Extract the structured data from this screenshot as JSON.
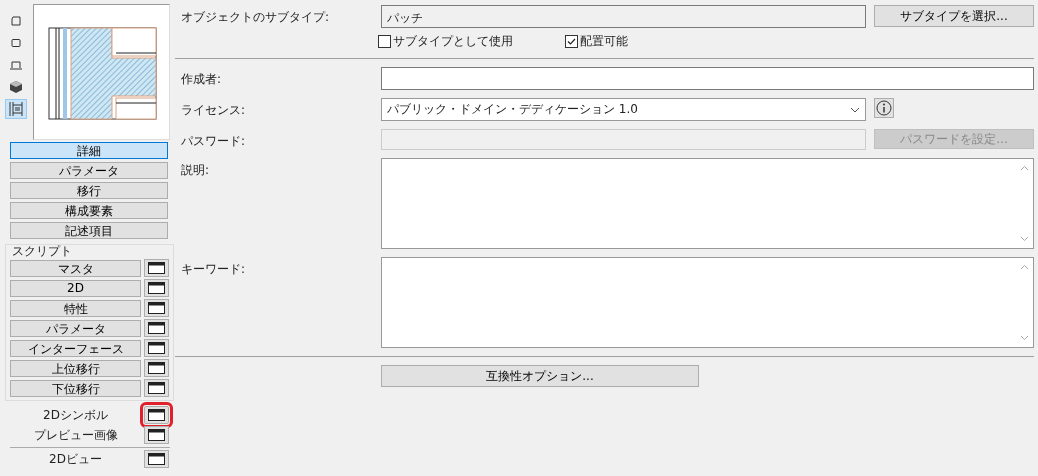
{
  "view_icons": [
    {
      "kind": "outline",
      "selected": false
    },
    {
      "kind": "square",
      "selected": false
    },
    {
      "kind": "elevation",
      "selected": false
    },
    {
      "kind": "cube",
      "selected": false
    },
    {
      "kind": "section",
      "selected": true
    }
  ],
  "tabs": [
    {
      "label": "詳細",
      "selected": true
    },
    {
      "label": "パラメータ",
      "selected": false
    },
    {
      "label": "移行",
      "selected": false
    },
    {
      "label": "構成要素",
      "selected": false
    },
    {
      "label": "記述項目",
      "selected": false
    }
  ],
  "scripts": {
    "title": "スクリプト",
    "items": [
      {
        "label": "マスタ"
      },
      {
        "label": "2D"
      },
      {
        "label": "特性"
      },
      {
        "label": "パラメータ"
      },
      {
        "label": "インターフェース"
      },
      {
        "label": "上位移行"
      },
      {
        "label": "下位移行"
      }
    ]
  },
  "extra_scripts": [
    {
      "label": "2Dシンボル",
      "highlighted": true
    },
    {
      "label": "プレビュー画像",
      "highlighted": false
    }
  ],
  "view_2d": {
    "label": "2Dビュー"
  },
  "subtype": {
    "label": "オブジェクトのサブタイプ:",
    "value": "パッチ",
    "button": "サブタイプを選択..."
  },
  "options": [
    {
      "label": "サブタイプとして使用",
      "checked": false
    },
    {
      "label": "配置可能",
      "checked": true
    }
  ],
  "author": {
    "label": "作成者:"
  },
  "license": {
    "label": "ライセンス:",
    "value": "パブリック・ドメイン・デディケーション 1.0"
  },
  "password": {
    "label": "パスワード:",
    "button": "パスワードを設定...",
    "disabled": true
  },
  "description": {
    "label": "説明:"
  },
  "keywords": {
    "label": "キーワード:"
  },
  "compat_button": "互換性オプション..."
}
